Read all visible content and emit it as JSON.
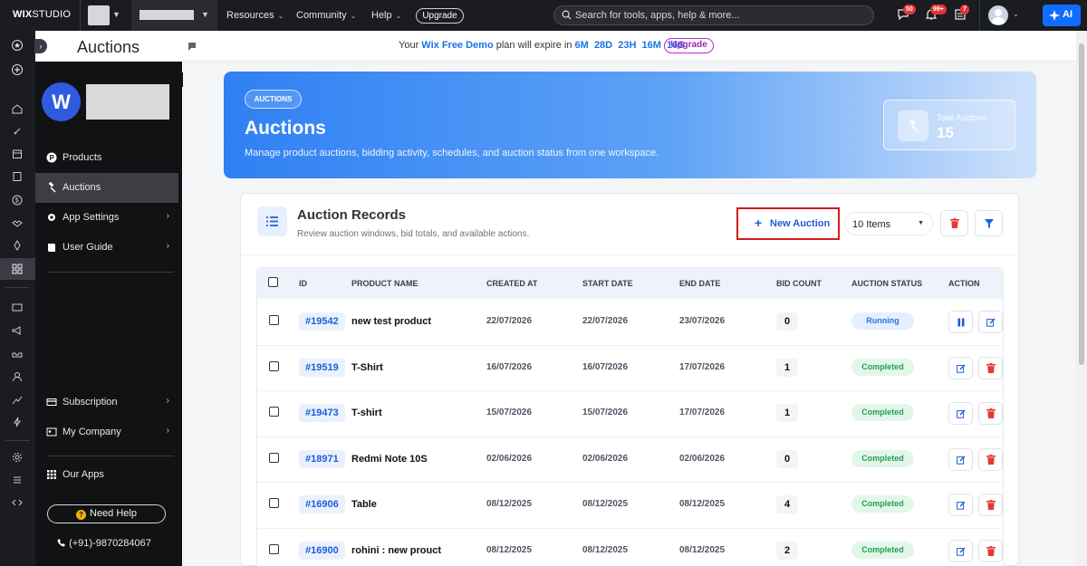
{
  "topbar": {
    "brand_bold": "WIX",
    "brand_light": "STUDIO",
    "nav": [
      "Resources",
      "Community",
      "Help"
    ],
    "upgrade_label": "Upgrade",
    "search_placeholder": "Search for tools, apps, help & more...",
    "badges": {
      "messages": "50",
      "notifications": "99+",
      "orders": "7"
    },
    "ai_label": "AI"
  },
  "header": {
    "page_title": "Auctions",
    "trial": {
      "prefix": "Your ",
      "plan": "Wix Free Demo",
      "middle": " plan will expire in ",
      "countdown": "6M  28D  23H  16M  16S",
      "upgrade_label": "Upgrade"
    }
  },
  "sidebar": {
    "logo_letter": "W",
    "items": [
      {
        "label": "Products",
        "has_chevron": false
      },
      {
        "label": "Auctions",
        "has_chevron": false
      },
      {
        "label": "App Settings",
        "has_chevron": true
      },
      {
        "label": "User Guide",
        "has_chevron": true
      }
    ],
    "bottom_items": [
      {
        "label": "Subscription"
      },
      {
        "label": "My Company"
      },
      {
        "label": "Our Apps"
      }
    ],
    "need_help_label": "Need Help",
    "phone": "(+91)-9870284067"
  },
  "hero": {
    "pill": "AUCTIONS",
    "title": "Auctions",
    "subtitle": "Manage product auctions, bidding activity, schedules, and auction status from one workspace.",
    "stat_label": "Total Auctions",
    "stat_value": "15"
  },
  "records": {
    "title": "Auction Records",
    "subtitle": "Review auction windows, bid totals, and available actions.",
    "new_button": "New Auction",
    "page_size": "10 Items",
    "columns": [
      "ID",
      "PRODUCT NAME",
      "CREATED AT",
      "START DATE",
      "END DATE",
      "BID COUNT",
      "AUCTION STATUS",
      "ACTION"
    ],
    "rows": [
      {
        "id": "#19542",
        "product": "new test product",
        "created": "22/07/2026",
        "start": "22/07/2026",
        "end": "23/07/2026",
        "bids": "0",
        "status": "Running"
      },
      {
        "id": "#19519",
        "product": "T-Shirt",
        "created": "16/07/2026",
        "start": "16/07/2026",
        "end": "17/07/2026",
        "bids": "1",
        "status": "Completed"
      },
      {
        "id": "#19473",
        "product": "T-shirt",
        "created": "15/07/2026",
        "start": "15/07/2026",
        "end": "17/07/2026",
        "bids": "1",
        "status": "Completed"
      },
      {
        "id": "#18971",
        "product": "Redmi Note 10S",
        "created": "02/06/2026",
        "start": "02/06/2026",
        "end": "02/06/2026",
        "bids": "0",
        "status": "Completed"
      },
      {
        "id": "#16906",
        "product": "Table",
        "created": "08/12/2025",
        "start": "08/12/2025",
        "end": "08/12/2025",
        "bids": "4",
        "status": "Completed"
      },
      {
        "id": "#16900",
        "product": "rohini : new prouct",
        "created": "08/12/2025",
        "start": "08/12/2025",
        "end": "08/12/2025",
        "bids": "2",
        "status": "Completed"
      }
    ]
  },
  "colors": {
    "accent": "#116dff",
    "hero_start": "#2f80f3",
    "running": "#2e6fe6",
    "completed": "#21a052",
    "delete": "#e53935",
    "highlight_border": "#d41b1b"
  }
}
